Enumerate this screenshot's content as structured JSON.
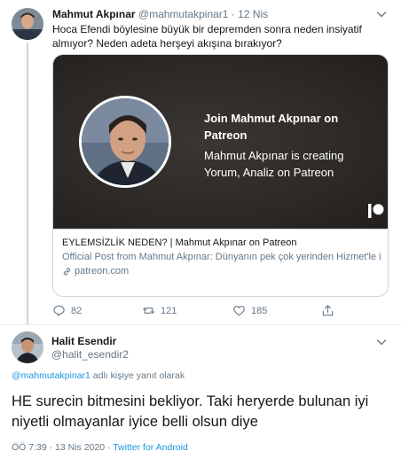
{
  "tweet": {
    "author_name": "Mahmut Akpınar",
    "author_handle": "@mahmutakpinar1",
    "separator": "·",
    "time": "12 Nis",
    "text": "Hoca Efendi böylesine büyük bir depremden sonra neden insiyatif almıyor? Neden adeta herşeyi akışına bırakıyor?",
    "card": {
      "join_text": "Join Mahmut Akpınar on Patreon",
      "creating_text": "Mahmut Akpınar is creating Yorum, Analiz on Patreon",
      "title": "EYLEMSİZLİK NEDEN? | Mahmut Akpınar on Patreon",
      "description": "Official Post from Mahmut Akpınar:   Dünyanın pek çok yerinden Hizmet'le ilgili dertlenen, sancı çeken pek çok arkadaşımız bana ulaşıyor...",
      "domain": "patreon.com"
    },
    "actions": {
      "replies": "82",
      "retweets": "121",
      "likes": "185"
    }
  },
  "reply": {
    "author_name": "Halit Esendir",
    "author_handle": "@halit_esendir2",
    "reply_mention": "@mahmutakpinar1",
    "reply_suffix": " adlı kişiye yanıt olarak",
    "text": "HE surecin bitmesini bekliyor. Taki heryerde bulunan iyi niyetli olmayanlar iyice belli olsun diye",
    "timestamp": "ÖÖ 7:39 · 13 Nis 2020 · ",
    "source": "Twitter for Android"
  },
  "icons": {
    "reply": "reply-icon",
    "retweet": "retweet-icon",
    "like": "heart-icon",
    "share": "share-icon",
    "caret": "chevron-down-icon",
    "link": "link-icon",
    "patreon": "patreon-logo-icon"
  },
  "colors": {
    "link": "#1b95e0",
    "secondary_text": "#657786",
    "border": "#ccd6dd"
  }
}
